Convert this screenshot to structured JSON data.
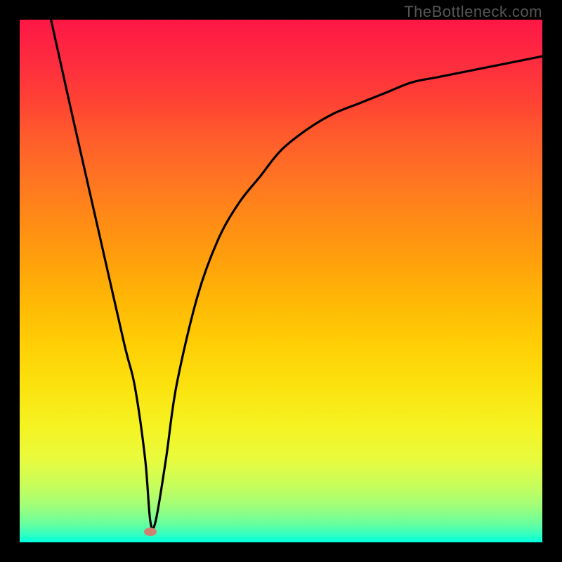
{
  "watermark": "TheBottleneck.com",
  "chart_data": {
    "type": "line",
    "title": "",
    "xlabel": "",
    "ylabel": "",
    "xlim": [
      0,
      100
    ],
    "ylim": [
      0,
      100
    ],
    "grid": false,
    "legend": false,
    "series": [
      {
        "name": "curve",
        "x": [
          6,
          10,
          15,
          20,
          22,
          24,
          25,
          26,
          28,
          30,
          34,
          38,
          42,
          46,
          50,
          55,
          60,
          65,
          70,
          75,
          80,
          85,
          90,
          95,
          100
        ],
        "y": [
          100,
          82,
          60,
          38,
          30,
          16,
          4,
          4,
          16,
          30,
          47,
          58,
          65,
          70,
          75,
          79,
          82,
          84,
          86,
          88,
          89,
          90,
          91,
          92,
          93
        ]
      }
    ],
    "marker": {
      "x": 25,
      "y": 2,
      "shape": "ellipse",
      "color": "#cf8171"
    },
    "background": "heat-gradient (green bottom to red top)"
  },
  "colors": {
    "frame": "#000000",
    "curve": "#000000",
    "marker": "#cf8171",
    "watermark": "#555555"
  }
}
